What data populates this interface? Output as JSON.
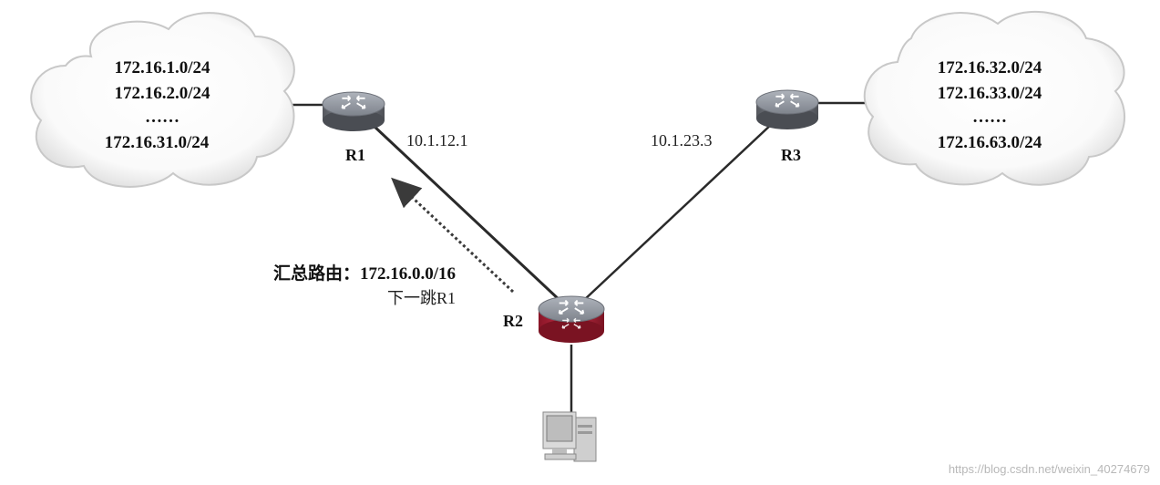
{
  "left_cloud": {
    "networks": [
      "172.16.1.0/24",
      "172.16.2.0/24",
      "……",
      "172.16.31.0/24"
    ]
  },
  "right_cloud": {
    "networks": [
      "172.16.32.0/24",
      "172.16.33.0/24",
      "……",
      "172.16.63.0/24"
    ]
  },
  "routers": {
    "r1": "R1",
    "r2": "R2",
    "r3": "R3"
  },
  "links": {
    "r1_r2_ip": "10.1.12.1",
    "r3_r2_ip": "10.1.23.3"
  },
  "summary": {
    "label": "汇总路由：172.16.0.0/16",
    "next_hop": "下一跳R1"
  },
  "watermark": "https://blog.csdn.net/weixin_40274679",
  "colors": {
    "router_top": "#8a8f99",
    "router_r2_bottom": "#b0243a",
    "line": "#2a2a2a",
    "cloud_edge": "#bdbdbd"
  }
}
